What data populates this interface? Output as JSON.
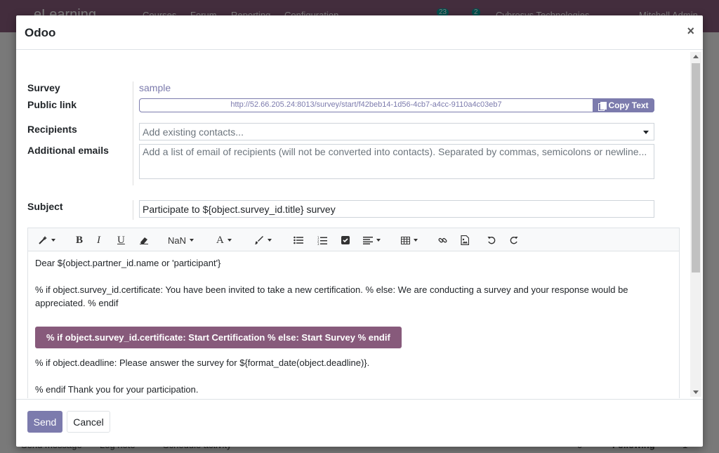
{
  "background": {
    "navbar": {
      "app_name": "eLearning",
      "menu": [
        "Courses",
        "Forum",
        "Reporting",
        "Configuration"
      ],
      "activity_count": "23",
      "message_count": "2",
      "company": "Cybrosys Technologies",
      "user": "Mitchell Admin"
    },
    "chatter": {
      "send_message": "Send message",
      "log_note": "Log note",
      "schedule_activity": "Schedule activity",
      "followers_count": "0",
      "following": "Following",
      "attachments_count": "1"
    }
  },
  "modal": {
    "title": "Odoo",
    "close_label": "×",
    "fields": {
      "survey_label": "Survey",
      "survey_value": "sample",
      "public_link_label": "Public link",
      "public_link_value": "http://52.66.205.24:8013/survey/start/f42beb14-1d56-4cb7-a4cc-9110a4c03eb7",
      "copy_text_label": "Copy Text",
      "recipients_label": "Recipients",
      "recipients_placeholder": "Add existing contacts...",
      "additional_emails_label": "Additional emails",
      "additional_emails_placeholder": "Add a list of email of recipients (will not be converted into contacts). Separated by commas, semicolons or newline...",
      "subject_label": "Subject",
      "subject_value": "Participate to ${object.survey_id.title} survey"
    },
    "editor": {
      "toolbar": {
        "font_size": "NaN"
      },
      "body": {
        "line1": "Dear ${object.partner_id.name or 'participant'}",
        "line2": "% if object.survey_id.certificate: You have been invited to take a new certification. % else: We are conducting a survey and your response would be appreciated. % endif",
        "cta": "% if object.survey_id.certificate: Start Certification % else: Start Survey % endif",
        "line3": "% if object.deadline: Please answer the survey for ${format_date(object.deadline)}.",
        "line4": "% endif Thank you for your participation."
      }
    },
    "footer": {
      "send_label": "Send",
      "cancel_label": "Cancel"
    }
  },
  "colors": {
    "primary": "#7c7bad",
    "brand": "#875a7b"
  }
}
